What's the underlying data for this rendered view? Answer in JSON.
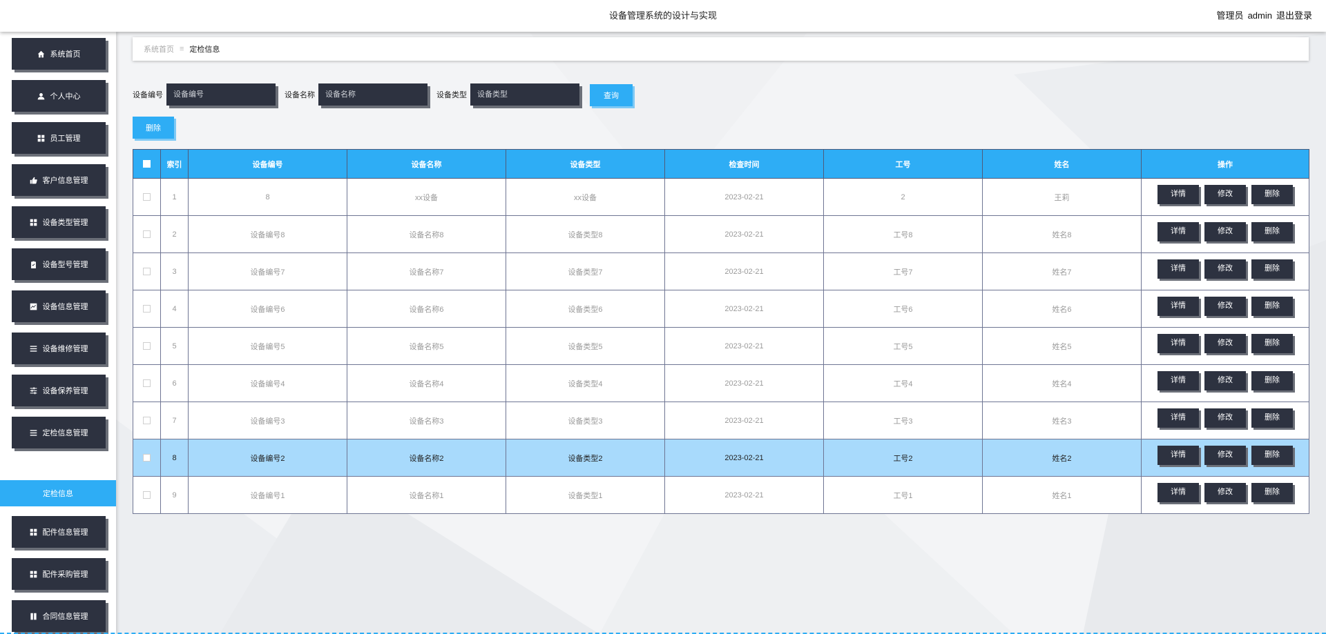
{
  "header": {
    "title": "设备管理系统的设计与实现",
    "role": "管理员",
    "username": "admin",
    "logout": "退出登录"
  },
  "sidebar": {
    "items": [
      {
        "label": "系统首页",
        "icon": "home-icon"
      },
      {
        "label": "个人中心",
        "icon": "user-icon"
      },
      {
        "label": "员工管理",
        "icon": "grid-icon"
      },
      {
        "label": "客户信息管理",
        "icon": "thumb-up-icon"
      },
      {
        "label": "设备类型管理",
        "icon": "grid-icon"
      },
      {
        "label": "设备型号管理",
        "icon": "clipboard-check-icon"
      },
      {
        "label": "设备信息管理",
        "icon": "chart-icon"
      },
      {
        "label": "设备维修管理",
        "icon": "list-icon"
      },
      {
        "label": "设备保养管理",
        "icon": "sliders-icon"
      },
      {
        "label": "定检信息管理",
        "icon": "list-icon"
      },
      {
        "label": "配件信息管理",
        "icon": "grid-icon"
      },
      {
        "label": "配件采购管理",
        "icon": "grid-icon"
      },
      {
        "label": "合同信息管理",
        "icon": "book-icon"
      }
    ],
    "active_sub": "定检信息"
  },
  "breadcrumb": {
    "home": "系统首页",
    "separator": "≡",
    "current": "定检信息"
  },
  "search": {
    "fields": [
      {
        "label": "设备编号",
        "placeholder": "设备编号"
      },
      {
        "label": "设备名称",
        "placeholder": "设备名称"
      },
      {
        "label": "设备类型",
        "placeholder": "设备类型"
      }
    ],
    "query_button": "查询",
    "delete_button": "删除"
  },
  "table": {
    "columns": [
      "索引",
      "设备编号",
      "设备名称",
      "设备类型",
      "检查时间",
      "工号",
      "姓名",
      "操作"
    ],
    "actions": [
      "详情",
      "修改",
      "删除"
    ],
    "highlighted_row": 8,
    "rows": [
      [
        "1",
        "8",
        "xx设备",
        "xx设备",
        "2023-02-21",
        "2",
        "王莉"
      ],
      [
        "2",
        "设备编号8",
        "设备名称8",
        "设备类型8",
        "2023-02-21",
        "工号8",
        "姓名8"
      ],
      [
        "3",
        "设备编号7",
        "设备名称7",
        "设备类型7",
        "2023-02-21",
        "工号7",
        "姓名7"
      ],
      [
        "4",
        "设备编号6",
        "设备名称6",
        "设备类型6",
        "2023-02-21",
        "工号6",
        "姓名6"
      ],
      [
        "5",
        "设备编号5",
        "设备名称5",
        "设备类型5",
        "2023-02-21",
        "工号5",
        "姓名5"
      ],
      [
        "6",
        "设备编号4",
        "设备名称4",
        "设备类型4",
        "2023-02-21",
        "工号4",
        "姓名4"
      ],
      [
        "7",
        "设备编号3",
        "设备名称3",
        "设备类型3",
        "2023-02-21",
        "工号3",
        "姓名3"
      ],
      [
        "8",
        "设备编号2",
        "设备名称2",
        "设备类型2",
        "2023-02-21",
        "工号2",
        "姓名2"
      ],
      [
        "9",
        "设备编号1",
        "设备名称1",
        "设备类型1",
        "2023-02-21",
        "工号1",
        "姓名1"
      ]
    ]
  },
  "colors": {
    "accent": "#2eadf5",
    "dark_button": "#2d3240",
    "highlight_row": "#a8dafc"
  }
}
